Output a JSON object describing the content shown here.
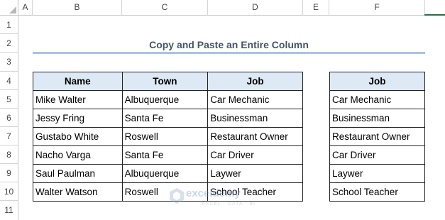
{
  "columns": [
    "A",
    "B",
    "C",
    "D",
    "E",
    "F"
  ],
  "rows": [
    "1",
    "2",
    "3",
    "4",
    "5",
    "6",
    "7",
    "8",
    "9",
    "10",
    "11"
  ],
  "title": "Copy and Paste an Entire Column",
  "main_table": {
    "headers": [
      "Name",
      "Town",
      "Job"
    ],
    "rows": [
      [
        "Mike Walter",
        "Albuquerque",
        "Car Mechanic"
      ],
      [
        "Jessy Fring",
        "Santa Fe",
        "Businessman"
      ],
      [
        "Gustabo White",
        "Roswell",
        "Restaurant Owner"
      ],
      [
        "Nacho Varga",
        "Santa Fe",
        "Car Driver"
      ],
      [
        "Saul Paulman",
        "Albuquerque",
        "Laywer"
      ],
      [
        "Walter Watson",
        "Roswell",
        "School Teacher"
      ]
    ]
  },
  "pasted_table": {
    "header": "Job",
    "rows": [
      "Car Mechanic",
      "Businessman",
      "Restaurant Owner",
      "Car Driver",
      "Laywer",
      "School Teacher"
    ]
  },
  "watermark": {
    "name": "exceldemy",
    "tagline": "EXCEL · DATA · BI"
  },
  "colors": {
    "header_fill": "#dde9f5",
    "title_color": "#44546a",
    "title_underline": "#a9c4e0",
    "accent_green": "#217346"
  }
}
